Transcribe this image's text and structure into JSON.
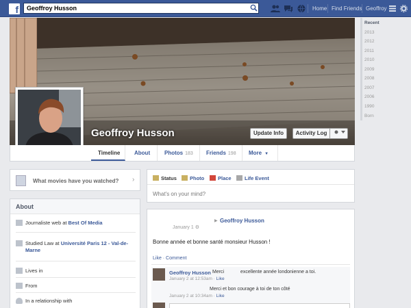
{
  "topbar": {
    "logo": "f",
    "search_value": "Geoffroy Husson",
    "nav": {
      "home": "Home",
      "find_friends": "Find Friends",
      "profile": "Geoffroy"
    }
  },
  "profile": {
    "name": "Geoffroy Husson",
    "update_info": "Update Info",
    "activity_log": "Activity Log"
  },
  "tabs": {
    "timeline": "Timeline",
    "about": "About",
    "photos": "Photos",
    "photos_count": "183",
    "friends": "Friends",
    "friends_count": "198",
    "more": "More"
  },
  "movies_prompt": "What movies have you watched?",
  "about": {
    "title": "About",
    "work_prefix": "Journaliste web at ",
    "work_place": "Best Of Media",
    "study_prefix": "Studied Law at ",
    "study_place": "Université Paris 12 - Val-de-Marne",
    "lives": "Lives in",
    "from": "From",
    "relationship": "In a relationship with"
  },
  "composer": {
    "status": "Status",
    "photo": "Photo",
    "place": "Place",
    "life_event": "Life Event",
    "placeholder": "What's on your mind?"
  },
  "post": {
    "author": "Geoffroy Husson",
    "date": "January 1",
    "text": "Bonne année et bonne santé monsieur Husson !",
    "actions": "Like · Comment",
    "comments": [
      {
        "author": "Geoffroy Husson",
        "text_a": "Merci",
        "text_b": "excellente année londonienne a toi.",
        "time": "January 2 at 12:53am",
        "like": "Like"
      },
      {
        "author": "",
        "text_a": "",
        "text_b": "Merci et bon courage à toi de ton côté",
        "time": "January 2 at 10:34am",
        "like": "Like"
      }
    ]
  },
  "years": [
    "Recent",
    "2013",
    "2012",
    "2011",
    "2010",
    "2009",
    "2008",
    "2007",
    "2006",
    "1990",
    "Born"
  ],
  "colors": {
    "brand": "#3b5998",
    "page_bg": "#e9eaed"
  }
}
